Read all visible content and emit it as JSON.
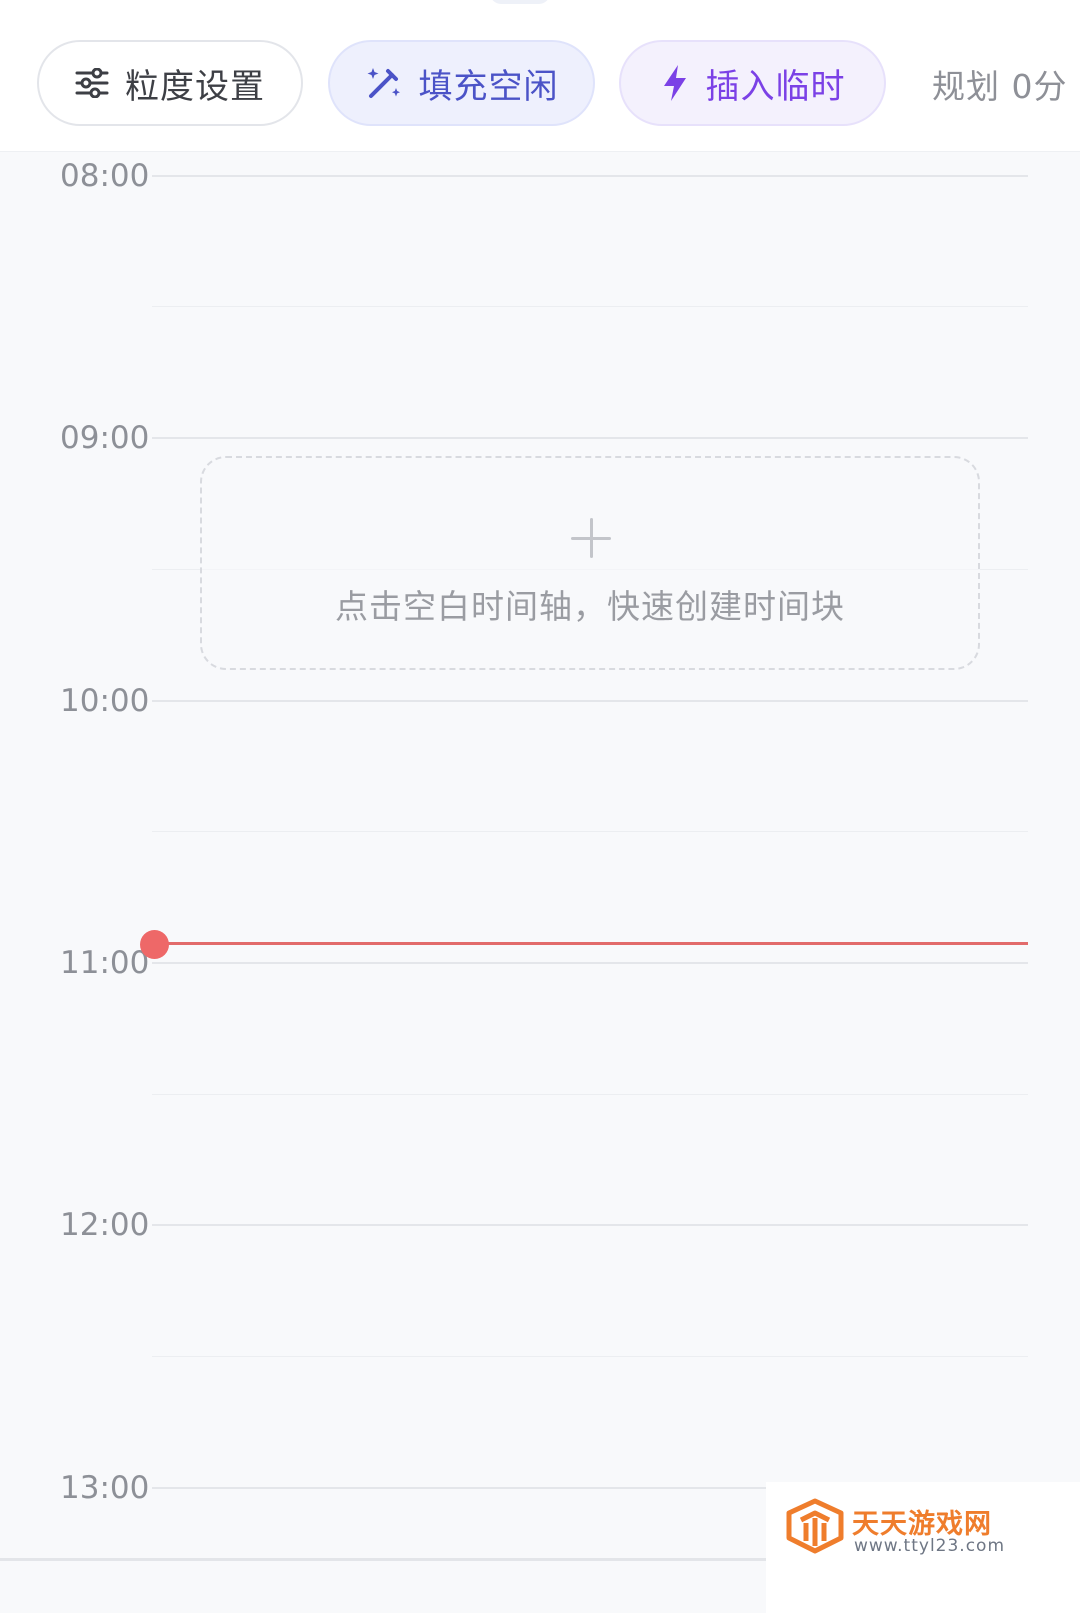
{
  "toolbar": {
    "granularity_label": "粒度设置",
    "fill_label": "填充空闲",
    "insert_label": "插入临时",
    "plan_text": "规划 0分"
  },
  "timeline": {
    "hours": [
      "08:00",
      "09:00",
      "10:00",
      "11:00",
      "12:00",
      "13:00"
    ],
    "empty_hint": "点击空白时间轴，快速创建时间块"
  },
  "watermark": {
    "title": "天天游戏网",
    "url": "www.ttyl23.com"
  },
  "colors": {
    "accent_blue": "#4b53c7",
    "accent_purple": "#7b41e6",
    "now_indicator": "#ee6868"
  },
  "icons": {
    "granularity": "sliders-icon",
    "fill": "magic-wand-icon",
    "insert": "lightning-icon",
    "empty": "plus-icon"
  }
}
